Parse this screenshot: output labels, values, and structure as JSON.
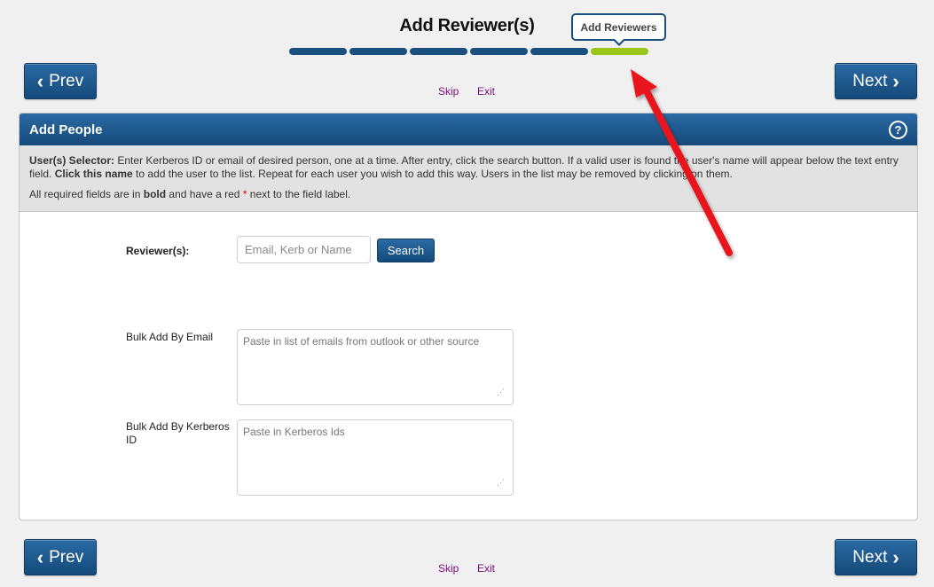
{
  "header": {
    "title": "Add Reviewer(s)",
    "current_step_label": "Add Reviewers",
    "progress": {
      "total_steps": 6,
      "current_step": 6
    }
  },
  "nav": {
    "prev_label": "Prev",
    "next_label": "Next",
    "prev_icon": "chevron-left-icon",
    "next_icon": "chevron-right-icon",
    "skip_label": "Skip",
    "exit_label": "Exit"
  },
  "panel": {
    "title": "Add People",
    "help_icon": "?",
    "instructions": {
      "selector_label": "User(s) Selector:",
      "text_1": " Enter Kerberos ID or email of desired person, one at a time. After entry, click the search button. If a valid user is found the user's name will appear below the text entry field. ",
      "click_bold": "Click this name",
      "text_2": " to add the user to the list. Repeat for each user you wish to add this way. Users in the list may be removed by clicking on them.",
      "req_1": "All required fields are in ",
      "req_bold": "bold",
      "req_2": " and have a red ",
      "req_star": "*",
      "req_3": " next to the field label."
    }
  },
  "form": {
    "reviewers_label": "Reviewer(s):",
    "reviewers_placeholder": "Email, Kerb or Name",
    "search_label": "Search",
    "bulk_email_label": "Bulk Add By Email",
    "bulk_email_placeholder": "Paste in list of emails from outlook or other source",
    "bulk_kerb_label": "Bulk Add By Kerberos ID",
    "bulk_kerb_placeholder": "Paste in Kerberos Ids"
  },
  "colors": {
    "primary": "#1b4f7e",
    "progress_active": "#9cc51c",
    "link": "#7a0a7a",
    "annotation_arrow": "#e8141c"
  }
}
